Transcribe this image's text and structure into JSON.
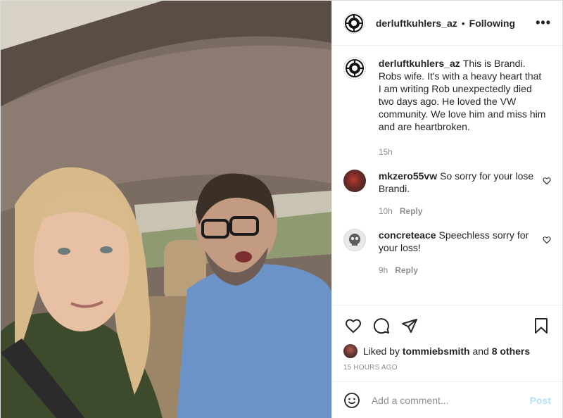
{
  "header": {
    "username": "derluftkuhlers_az",
    "separator": "•",
    "follow_status": "Following",
    "more_glyph": "•••"
  },
  "caption": {
    "username": "derluftkuhlers_az",
    "text": "This is Brandi. Robs wife. It's with a heavy heart that I am writing Rob unexpectedly died two days ago. He loved the VW community. We love him and miss him and are heartbroken.",
    "time": "15h"
  },
  "comments": [
    {
      "username": "mkzero55vw",
      "text": "So sorry for your lose Brandi.",
      "time": "10h",
      "reply_label": "Reply"
    },
    {
      "username": "concreteace",
      "text": "Speechless sorry for your loss!",
      "time": "9h",
      "reply_label": "Reply"
    }
  ],
  "likes": {
    "prefix": "Liked by",
    "first_user": "tommiebsmith",
    "connector": "and",
    "others": "8 others"
  },
  "timestamp": "15 HOURS AGO",
  "add_comment": {
    "placeholder": "Add a comment...",
    "post_label": "Post"
  },
  "icons": {
    "like": "heart-icon",
    "comment": "comment-icon",
    "share": "share-icon",
    "save": "bookmark-icon",
    "emoji": "emoji-icon"
  },
  "colors": {
    "text": "#262626",
    "muted": "#8e8e8e",
    "post_button_disabled": "#b2dffc",
    "border": "#efefef"
  }
}
